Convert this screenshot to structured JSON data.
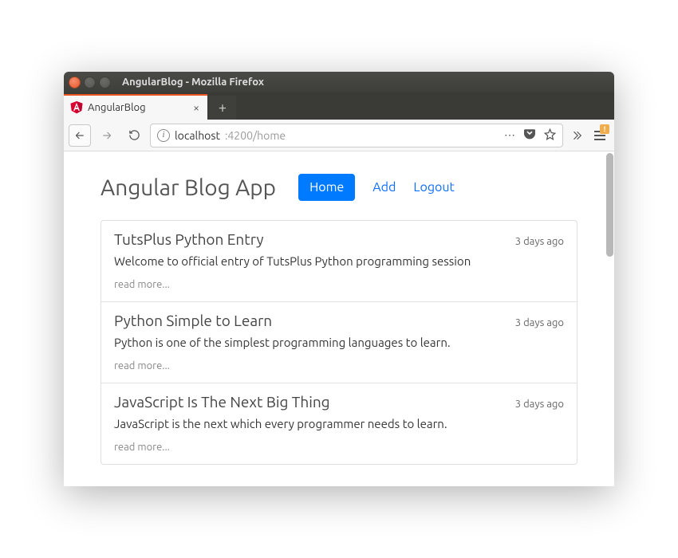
{
  "window": {
    "title": "AngularBlog - Mozilla Firefox"
  },
  "tab": {
    "title": "AngularBlog"
  },
  "url": {
    "host": "localhost",
    "path": ":4200/home"
  },
  "page": {
    "title": "Angular Blog App",
    "nav": {
      "home": "Home",
      "add": "Add",
      "logout": "Logout"
    }
  },
  "posts": [
    {
      "title": "TutsPlus Python Entry",
      "time": "3 days ago",
      "body": "Welcome to official entry of TutsPlus Python programming session",
      "more": "read more..."
    },
    {
      "title": "Python Simple to Learn",
      "time": "3 days ago",
      "body": "Python is one of the simplest programming languages to learn.",
      "more": "read more..."
    },
    {
      "title": "JavaScript Is The Next Big Thing",
      "time": "3 days ago",
      "body": "JavaScript is the next which every programmer needs to learn.",
      "more": "read more..."
    }
  ],
  "urlbar_dots": "⋯"
}
